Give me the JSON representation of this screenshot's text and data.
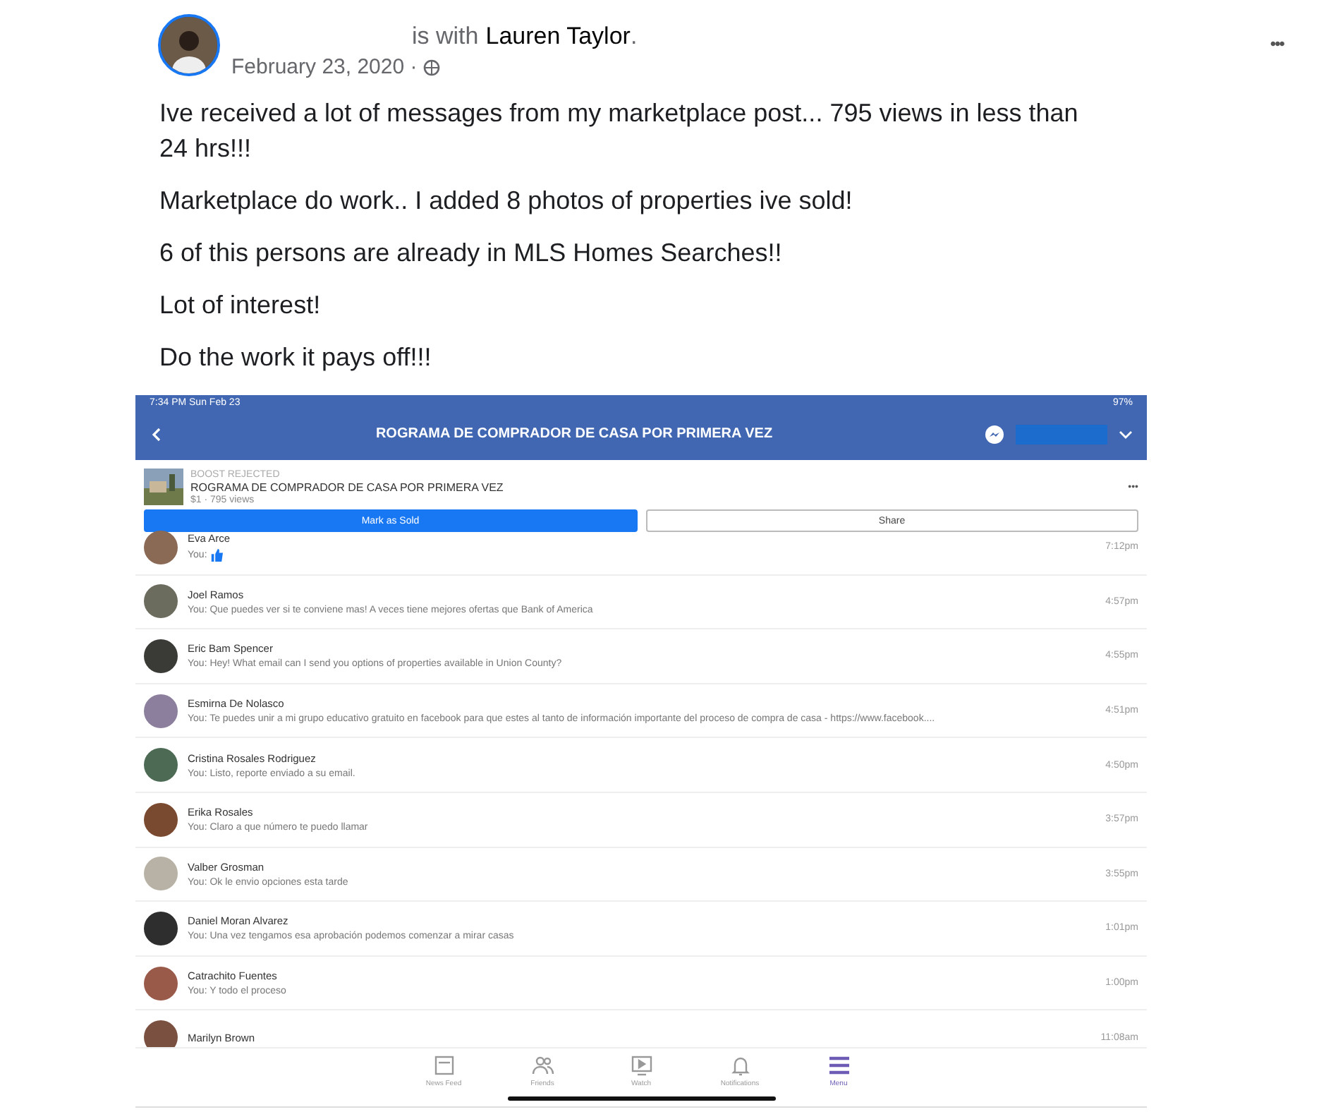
{
  "post": {
    "with_text": "is with",
    "tagged": "Lauren Taylor",
    "tagged_end": ".",
    "date": "February 23, 2020 ·",
    "more": "•••",
    "paragraphs": [
      "Ive received a lot of messages from my marketplace post... 795 views in less than 24 hrs!!!",
      "Marketplace do work.. I added 8 photos of properties ive sold!",
      "6 of this persons are already in MLS Homes Searches!!",
      "Lot of interest!",
      "Do the work it pays off!!!"
    ]
  },
  "phone": {
    "status_time": "7:34 PM  Sun Feb 23",
    "battery": "97%",
    "title": "ROGRAMA DE COMPRADOR DE CASA POR PRIMERA VEZ",
    "listing": {
      "status": "BOOST REJECTED",
      "title": "ROGRAMA DE COMPRADOR DE CASA POR PRIMERA VEZ",
      "stats": "$1 · 795 views",
      "more": "•••"
    },
    "buttons": [
      {
        "label": "Mark as Sold",
        "kind": "primary"
      },
      {
        "label": "Share",
        "kind": "secondary"
      }
    ],
    "conversations": [
      {
        "name": "Eva Arce",
        "message": "You:",
        "kind": "like",
        "time": "7:12pm",
        "color": "#8a6a55"
      },
      {
        "name": "Joel Ramos",
        "message": "You: Que puedes ver si te conviene mas! A veces tiene mejores ofertas que Bank of America",
        "kind": "text",
        "time": "4:57pm",
        "color": "#6b6b5e"
      },
      {
        "name": "Eric Bam Spencer",
        "message": "You: Hey! What email can I send you options of properties available in Union County?",
        "kind": "text",
        "time": "4:55pm",
        "color": "#3a3a36"
      },
      {
        "name": "Esmirna De Nolasco",
        "message": "You: Te puedes unir a mi grupo educativo gratuito en facebook para que estes al tanto de información importante del proceso de compra de casa - https://www.facebook....",
        "kind": "text",
        "time": "4:51pm",
        "color": "#8c7f9e"
      },
      {
        "name": "Cristina Rosales Rodriguez",
        "message": "You: Listo, reporte enviado a su email.",
        "kind": "text",
        "time": "4:50pm",
        "color": "#4d6a55"
      },
      {
        "name": "Erika Rosales",
        "message": "You: Claro  a que número te puedo llamar",
        "kind": "text",
        "time": "3:57pm",
        "color": "#7a4a30"
      },
      {
        "name": "Valber Grosman",
        "message": "You: Ok le envio opciones esta tarde",
        "kind": "text",
        "time": "3:55pm",
        "color": "#b8b2a6"
      },
      {
        "name": "Daniel Moran Alvarez",
        "message": "You: Una vez tengamos esa aprobación podemos comenzar a mirar casas",
        "kind": "text",
        "time": "1:01pm",
        "color": "#2e2e2e"
      },
      {
        "name": "Catrachito Fuentes",
        "message": "You: Y todo el proceso",
        "kind": "text",
        "time": "1:00pm",
        "color": "#9a5a4a"
      },
      {
        "name": "Marilyn Brown",
        "kind": "cut",
        "time": "11:08am",
        "color": "#7a5040"
      }
    ],
    "tabs": [
      {
        "label": "News Feed",
        "kind": "feed",
        "selected": false
      },
      {
        "label": "Friends",
        "kind": "friends",
        "selected": false
      },
      {
        "label": "Watch",
        "kind": "watch",
        "selected": false
      },
      {
        "label": "Notifications",
        "kind": "bell",
        "selected": false
      },
      {
        "label": "Menu",
        "kind": "menu",
        "selected": true
      }
    ]
  }
}
